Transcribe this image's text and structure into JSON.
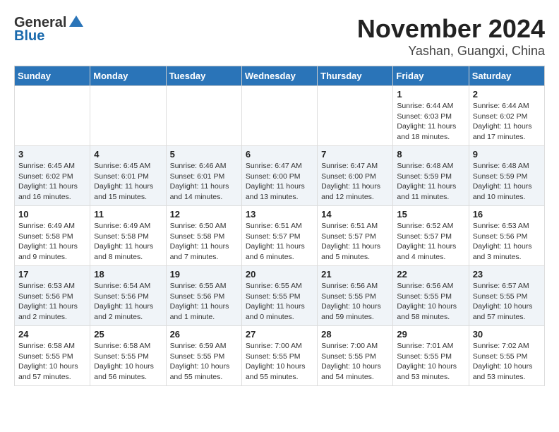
{
  "header": {
    "logo_general": "General",
    "logo_blue": "Blue",
    "month": "November 2024",
    "location": "Yashan, Guangxi, China"
  },
  "weekdays": [
    "Sunday",
    "Monday",
    "Tuesday",
    "Wednesday",
    "Thursday",
    "Friday",
    "Saturday"
  ],
  "weeks": [
    [
      {
        "day": "",
        "info": ""
      },
      {
        "day": "",
        "info": ""
      },
      {
        "day": "",
        "info": ""
      },
      {
        "day": "",
        "info": ""
      },
      {
        "day": "",
        "info": ""
      },
      {
        "day": "1",
        "info": "Sunrise: 6:44 AM\nSunset: 6:03 PM\nDaylight: 11 hours and 18 minutes."
      },
      {
        "day": "2",
        "info": "Sunrise: 6:44 AM\nSunset: 6:02 PM\nDaylight: 11 hours and 17 minutes."
      }
    ],
    [
      {
        "day": "3",
        "info": "Sunrise: 6:45 AM\nSunset: 6:02 PM\nDaylight: 11 hours and 16 minutes."
      },
      {
        "day": "4",
        "info": "Sunrise: 6:45 AM\nSunset: 6:01 PM\nDaylight: 11 hours and 15 minutes."
      },
      {
        "day": "5",
        "info": "Sunrise: 6:46 AM\nSunset: 6:01 PM\nDaylight: 11 hours and 14 minutes."
      },
      {
        "day": "6",
        "info": "Sunrise: 6:47 AM\nSunset: 6:00 PM\nDaylight: 11 hours and 13 minutes."
      },
      {
        "day": "7",
        "info": "Sunrise: 6:47 AM\nSunset: 6:00 PM\nDaylight: 11 hours and 12 minutes."
      },
      {
        "day": "8",
        "info": "Sunrise: 6:48 AM\nSunset: 5:59 PM\nDaylight: 11 hours and 11 minutes."
      },
      {
        "day": "9",
        "info": "Sunrise: 6:48 AM\nSunset: 5:59 PM\nDaylight: 11 hours and 10 minutes."
      }
    ],
    [
      {
        "day": "10",
        "info": "Sunrise: 6:49 AM\nSunset: 5:58 PM\nDaylight: 11 hours and 9 minutes."
      },
      {
        "day": "11",
        "info": "Sunrise: 6:49 AM\nSunset: 5:58 PM\nDaylight: 11 hours and 8 minutes."
      },
      {
        "day": "12",
        "info": "Sunrise: 6:50 AM\nSunset: 5:58 PM\nDaylight: 11 hours and 7 minutes."
      },
      {
        "day": "13",
        "info": "Sunrise: 6:51 AM\nSunset: 5:57 PM\nDaylight: 11 hours and 6 minutes."
      },
      {
        "day": "14",
        "info": "Sunrise: 6:51 AM\nSunset: 5:57 PM\nDaylight: 11 hours and 5 minutes."
      },
      {
        "day": "15",
        "info": "Sunrise: 6:52 AM\nSunset: 5:57 PM\nDaylight: 11 hours and 4 minutes."
      },
      {
        "day": "16",
        "info": "Sunrise: 6:53 AM\nSunset: 5:56 PM\nDaylight: 11 hours and 3 minutes."
      }
    ],
    [
      {
        "day": "17",
        "info": "Sunrise: 6:53 AM\nSunset: 5:56 PM\nDaylight: 11 hours and 2 minutes."
      },
      {
        "day": "18",
        "info": "Sunrise: 6:54 AM\nSunset: 5:56 PM\nDaylight: 11 hours and 2 minutes."
      },
      {
        "day": "19",
        "info": "Sunrise: 6:55 AM\nSunset: 5:56 PM\nDaylight: 11 hours and 1 minute."
      },
      {
        "day": "20",
        "info": "Sunrise: 6:55 AM\nSunset: 5:55 PM\nDaylight: 11 hours and 0 minutes."
      },
      {
        "day": "21",
        "info": "Sunrise: 6:56 AM\nSunset: 5:55 PM\nDaylight: 10 hours and 59 minutes."
      },
      {
        "day": "22",
        "info": "Sunrise: 6:56 AM\nSunset: 5:55 PM\nDaylight: 10 hours and 58 minutes."
      },
      {
        "day": "23",
        "info": "Sunrise: 6:57 AM\nSunset: 5:55 PM\nDaylight: 10 hours and 57 minutes."
      }
    ],
    [
      {
        "day": "24",
        "info": "Sunrise: 6:58 AM\nSunset: 5:55 PM\nDaylight: 10 hours and 57 minutes."
      },
      {
        "day": "25",
        "info": "Sunrise: 6:58 AM\nSunset: 5:55 PM\nDaylight: 10 hours and 56 minutes."
      },
      {
        "day": "26",
        "info": "Sunrise: 6:59 AM\nSunset: 5:55 PM\nDaylight: 10 hours and 55 minutes."
      },
      {
        "day": "27",
        "info": "Sunrise: 7:00 AM\nSunset: 5:55 PM\nDaylight: 10 hours and 55 minutes."
      },
      {
        "day": "28",
        "info": "Sunrise: 7:00 AM\nSunset: 5:55 PM\nDaylight: 10 hours and 54 minutes."
      },
      {
        "day": "29",
        "info": "Sunrise: 7:01 AM\nSunset: 5:55 PM\nDaylight: 10 hours and 53 minutes."
      },
      {
        "day": "30",
        "info": "Sunrise: 7:02 AM\nSunset: 5:55 PM\nDaylight: 10 hours and 53 minutes."
      }
    ]
  ]
}
